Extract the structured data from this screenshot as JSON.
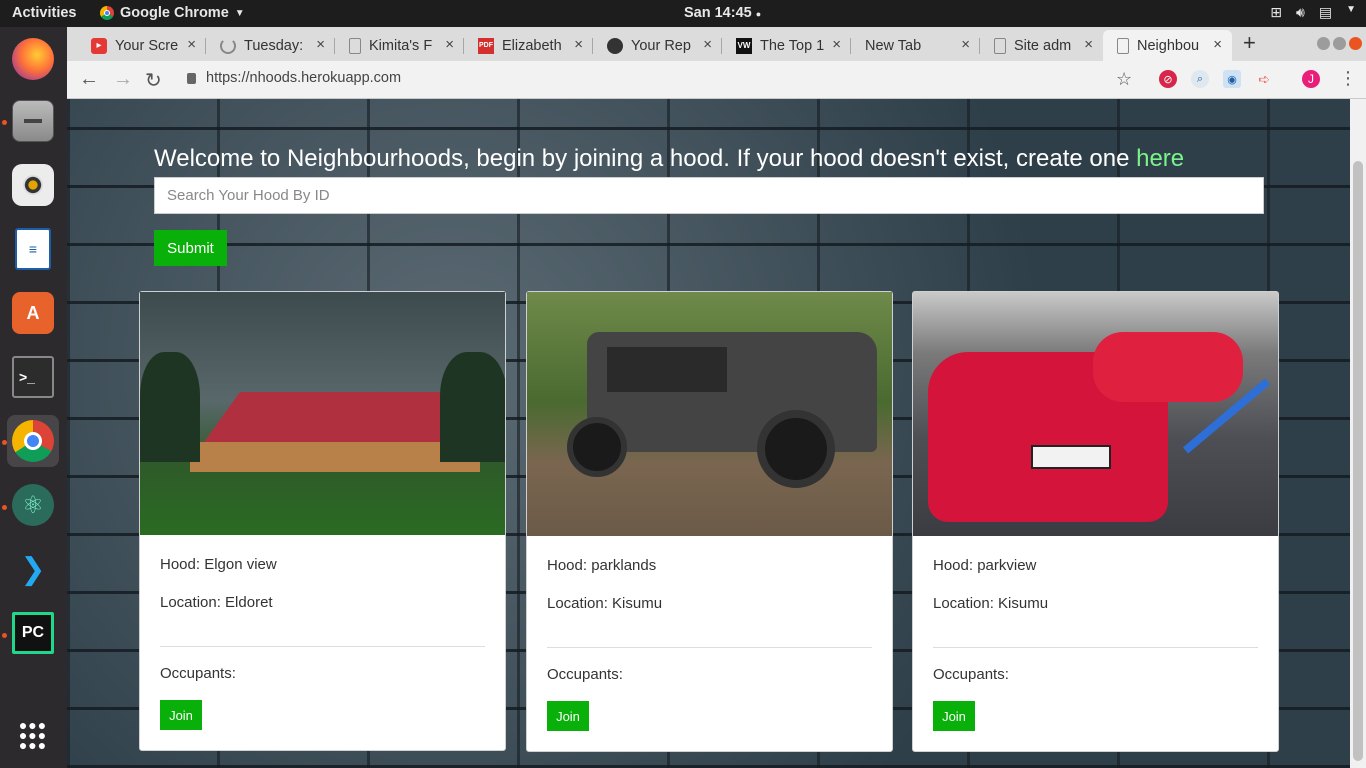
{
  "system": {
    "activities": "Activities",
    "app_name": "Google Chrome",
    "clock": "San 14:45"
  },
  "browser": {
    "tabs": [
      {
        "label": "Your Scre",
        "icon": "video-record-icon"
      },
      {
        "label": "Tuesday:",
        "icon": "loading-icon"
      },
      {
        "label": "Kimita's F",
        "icon": "page-icon"
      },
      {
        "label": "Elizabeth",
        "icon": "pdf-icon",
        "icon_text": "PDF"
      },
      {
        "label": "Your Rep",
        "icon": "github-icon"
      },
      {
        "label": "The Top 1",
        "icon": "vw-icon",
        "icon_text": "VW"
      },
      {
        "label": "New Tab",
        "icon": ""
      },
      {
        "label": "Site adm",
        "icon": "page-icon"
      },
      {
        "label": "Neighbou",
        "icon": "page-icon"
      }
    ],
    "active_tab": 8,
    "url": "https://nhoods.herokuapp.com",
    "profile_initial": "J"
  },
  "page": {
    "welcome_text": "Welcome to Neighbourhoods, begin by joining a hood. If your hood doesn't exist, create one ",
    "welcome_link": "here",
    "search_placeholder": "Search Your Hood By ID",
    "submit_label": "Submit",
    "cards": [
      {
        "hood": "Hood: Elgon view",
        "location": "Location: Eldoret",
        "occupants": "Occupants:",
        "join": "Join"
      },
      {
        "hood": "Hood: parklands",
        "location": "Location: Kisumu",
        "occupants": "Occupants:",
        "join": "Join"
      },
      {
        "hood": "Hood: parkview",
        "location": "Location: Kisumu",
        "occupants": "Occupants:",
        "join": "Join"
      }
    ]
  },
  "colors": {
    "accent_green": "#0ab00a",
    "link_green": "#7cf28a",
    "ubuntu_orange": "#e95420"
  }
}
